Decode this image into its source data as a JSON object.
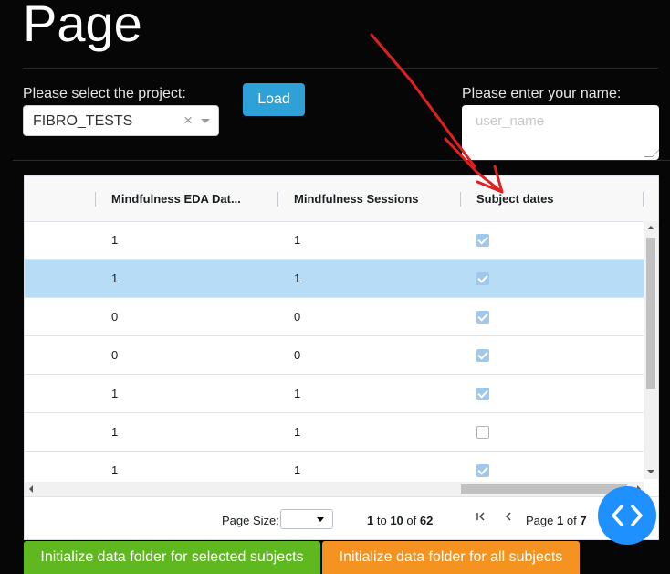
{
  "page": {
    "title": "Page"
  },
  "project": {
    "label": "Please select the project:",
    "selected": "FIBRO_TESTS",
    "clear_glyph": "×"
  },
  "load_button": {
    "label": "Load"
  },
  "user": {
    "label": "Please enter your name:",
    "placeholder": "user_name"
  },
  "grid": {
    "columns": [
      "Mindfulness EDA Dat...",
      "Mindfulness Sessions",
      "Subject dates"
    ],
    "rows": [
      {
        "eda": "1",
        "sessions": "1",
        "dates": true,
        "selected": false
      },
      {
        "eda": "1",
        "sessions": "1",
        "dates": true,
        "selected": true
      },
      {
        "eda": "0",
        "sessions": "0",
        "dates": true,
        "selected": false
      },
      {
        "eda": "0",
        "sessions": "0",
        "dates": true,
        "selected": false
      },
      {
        "eda": "1",
        "sessions": "1",
        "dates": true,
        "selected": false
      },
      {
        "eda": "1",
        "sessions": "1",
        "dates": false,
        "selected": false
      },
      {
        "eda": "1",
        "sessions": "1",
        "dates": true,
        "selected": false
      }
    ]
  },
  "pagination": {
    "page_size_label": "Page Size:",
    "row_from": "1",
    "to_word": "to",
    "row_to": "10",
    "of_word": "of",
    "row_total": "62",
    "page_word": "Page",
    "page_current": "1",
    "page_of_word": "of",
    "page_total": "7"
  },
  "actions": {
    "init_selected": "Initialize data folder for selected subjects",
    "init_all": "Initialize data folder for all subjects"
  },
  "colors": {
    "load_button": "#2ea2d8",
    "selected_row": "#b7dcf6",
    "fab": "#1e90ff",
    "init_selected": "#5fb81f",
    "init_all": "#f59321",
    "annotation_arrow": "#e02020"
  },
  "icons": {
    "fab": "code-brackets-icon",
    "first_page": "first-page-icon",
    "prev_page": "previous-page-icon"
  }
}
